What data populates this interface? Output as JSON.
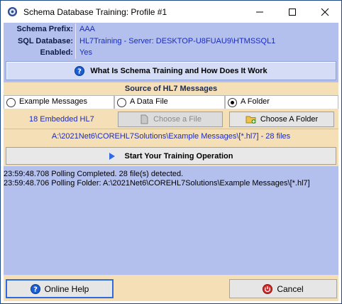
{
  "window": {
    "title": "Schema Database Training: Profile #1"
  },
  "info": [
    {
      "label": "Schema Prefix:",
      "value": "AAA"
    },
    {
      "label": "SQL Database:",
      "value": "HL7Training  - Server: DESKTOP-U8FUAU9\\HTMSSQL1"
    },
    {
      "label": "Enabled:",
      "value": "Yes"
    }
  ],
  "what_is_button": {
    "label": "What Is Schema Training and How Does It Work"
  },
  "source": {
    "title": "Source of HL7 Messages",
    "options": [
      {
        "label": "Example Messages",
        "selected": false
      },
      {
        "label": "A Data File",
        "selected": false
      },
      {
        "label": "A Folder",
        "selected": true
      }
    ],
    "embedded_label": "18 Embedded HL7",
    "choose_file_label": "Choose a File",
    "choose_folder_label": "Choose A Folder",
    "path": "A:\\2021Net6\\COREHL7Solutions\\Example Messages\\[*.hl7] - 28 files"
  },
  "start_button": {
    "label": "Start Your Training Operation"
  },
  "log": [
    "23:59:48.708 Polling Completed. 28 file(s) detected.",
    "23:59:48.706 Polling Folder: A:\\2021Net6\\COREHL7Solutions\\Example Messages\\[*.hl7]"
  ],
  "footer": {
    "help_label": "Online Help",
    "cancel_label": "Cancel"
  },
  "colors": {
    "panel": "#b3c0ee",
    "tan": "#f5dfb6",
    "value_blue": "#1a2bc0",
    "label_navy": "#0e1a47"
  }
}
